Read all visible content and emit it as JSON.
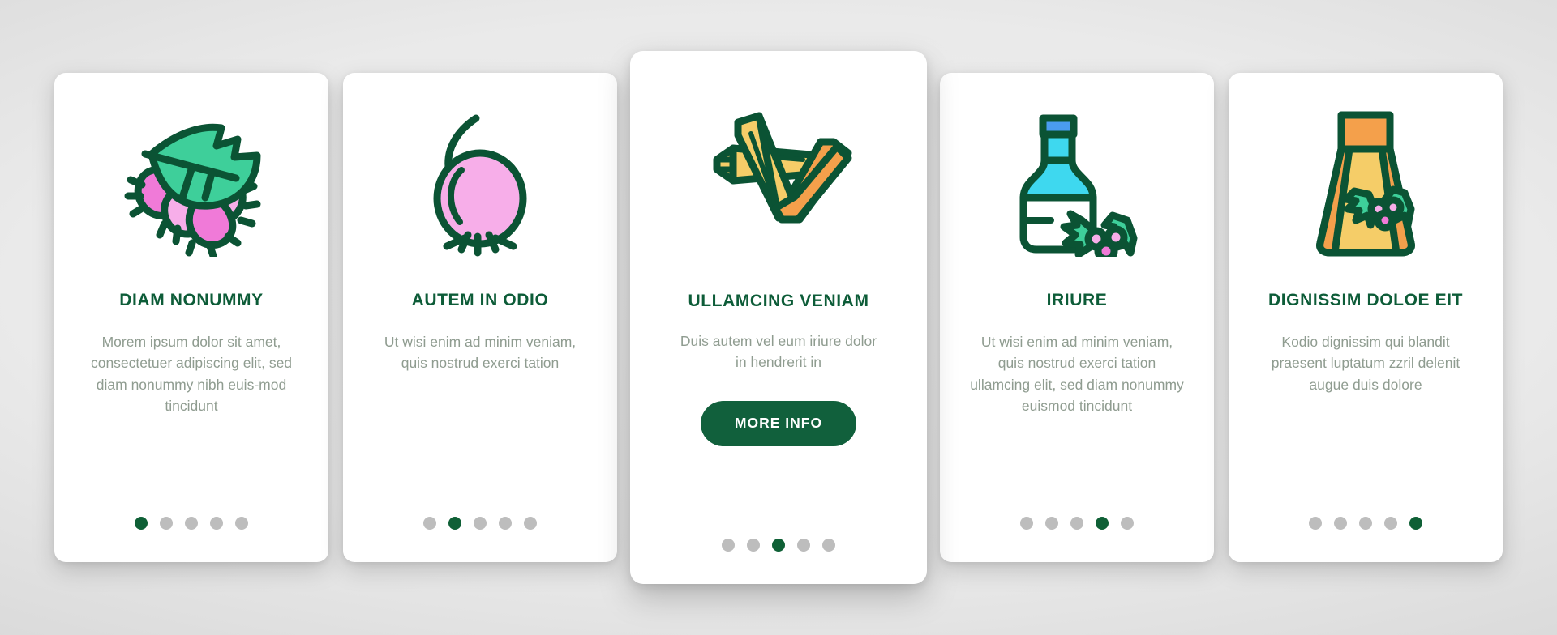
{
  "theme": {
    "accent_green": "#0d5c38",
    "button_green": "#11603c",
    "body_text_gray": "#8f9c90",
    "dot_inactive": "#bdbdbd",
    "dot_active": "#0f6036",
    "card_bg": "#ffffff",
    "icon_outline": "#0b5334",
    "icon_pink": "#f07ad8",
    "icon_pink_light": "#f7aee9",
    "icon_teal": "#3ecf9a",
    "icon_orange": "#f4a04b",
    "icon_yellow": "#f5cd68",
    "icon_cyan": "#3ed8ef",
    "icon_blue": "#4a9cf0"
  },
  "cards": [
    {
      "icon_name": "berries-with-leaf-icon",
      "title": "DIAM NONUMMY",
      "body": "Morem ipsum dolor sit amet, consectetuer adipiscing elit, sed diam nonummy nibh euis-mod tincidunt",
      "featured": false,
      "dots": {
        "count": 5,
        "active": 1
      }
    },
    {
      "icon_name": "gooseberry-icon",
      "title": "AUTEM IN ODIO",
      "body": "Ut wisi enim ad minim veniam, quis nostrud exerci tation",
      "featured": false,
      "dots": {
        "count": 5,
        "active": 2
      }
    },
    {
      "icon_name": "cinnamon-sticks-icon",
      "title": "ULLAMCING VENIAM",
      "body": "Duis autem vel eum iriure dolor in hendrerit in",
      "button_label": "MORE INFO",
      "featured": true,
      "dots": {
        "count": 5,
        "active": 3
      }
    },
    {
      "icon_name": "bottle-with-berries-icon",
      "title": "IRIURE",
      "body": "Ut wisi enim ad minim veniam, quis nostrud exerci tation ullamcing elit, sed diam nonummy euismod tincidunt",
      "featured": false,
      "dots": {
        "count": 5,
        "active": 4
      }
    },
    {
      "icon_name": "spice-shaker-icon",
      "title": "DIGNISSIM DOLOE EIT",
      "body": "Kodio dignissim qui blandit praesent luptatum zzril delenit augue duis dolore",
      "featured": false,
      "dots": {
        "count": 5,
        "active": 5
      }
    }
  ]
}
